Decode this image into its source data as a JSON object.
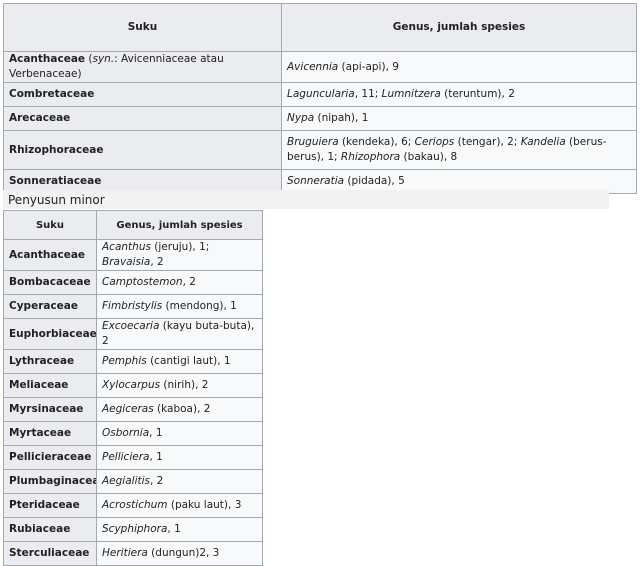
{
  "major": {
    "headers": [
      "Suku",
      "Genus, jumlah spesies"
    ],
    "rows": [
      {
        "suku": "Acanthaceae",
        "syn_pre": " (",
        "syn_label": "syn.",
        "syn_post": ": Avicenniaceae atau Verbenaceae)",
        "genus": [
          {
            "t": "Avicennia",
            "i": true
          },
          {
            "t": " (api-api), 9",
            "i": false
          }
        ]
      },
      {
        "suku": "Combretaceae",
        "genus": [
          {
            "t": "Laguncularia",
            "i": true
          },
          {
            "t": ", 11; ",
            "i": false
          },
          {
            "t": "Lumnitzera",
            "i": true
          },
          {
            "t": " (teruntum), 2",
            "i": false
          }
        ]
      },
      {
        "suku": "Arecaceae",
        "genus": [
          {
            "t": "Nypa",
            "i": true
          },
          {
            "t": " (nipah), 1",
            "i": false
          }
        ]
      },
      {
        "suku": "Rhizophoraceae",
        "genus": [
          {
            "t": "Bruguiera",
            "i": true
          },
          {
            "t": " (kendeka), 6; ",
            "i": false
          },
          {
            "t": "Ceriops",
            "i": true
          },
          {
            "t": " (tengar), 2; ",
            "i": false
          },
          {
            "t": "Kandelia",
            "i": true
          },
          {
            "t": " (berus-berus), 1; ",
            "i": false
          },
          {
            "t": "Rhizophora",
            "i": true
          },
          {
            "t": " (bakau), 8",
            "i": false
          }
        ]
      },
      {
        "suku": "Sonneratiaceae",
        "genus": [
          {
            "t": "Sonneratia",
            "i": true
          },
          {
            "t": " (pidada), 5",
            "i": false
          }
        ]
      }
    ]
  },
  "minor": {
    "heading": "Penyusun minor",
    "headers": [
      "Suku",
      "Genus, jumlah spesies"
    ],
    "rows": [
      {
        "suku": "Acanthaceae",
        "genus": [
          {
            "t": "Acanthus",
            "i": true
          },
          {
            "t": " (jeruju), 1; ",
            "i": false
          },
          {
            "t": "Bravaisia",
            "i": true
          },
          {
            "t": ", 2",
            "i": false
          }
        ]
      },
      {
        "suku": "Bombacaceae",
        "genus": [
          {
            "t": "Camptostemon",
            "i": true
          },
          {
            "t": ", 2",
            "i": false
          }
        ]
      },
      {
        "suku": "Cyperaceae",
        "genus": [
          {
            "t": "Fimbristylis",
            "i": true
          },
          {
            "t": " (mendong), 1",
            "i": false
          }
        ]
      },
      {
        "suku": "Euphorbiaceae",
        "genus": [
          {
            "t": "Excoecaria",
            "i": true
          },
          {
            "t": " (kayu buta-buta), 2",
            "i": false
          }
        ]
      },
      {
        "suku": "Lythraceae",
        "genus": [
          {
            "t": "Pemphis",
            "i": true
          },
          {
            "t": " (cantigi laut), 1",
            "i": false
          }
        ]
      },
      {
        "suku": "Meliaceae",
        "genus": [
          {
            "t": "Xylocarpus",
            "i": true
          },
          {
            "t": " (nirih), 2",
            "i": false
          }
        ]
      },
      {
        "suku": "Myrsinaceae",
        "genus": [
          {
            "t": "Aegiceras",
            "i": true
          },
          {
            "t": " (kaboa), 2",
            "i": false
          }
        ]
      },
      {
        "suku": "Myrtaceae",
        "genus": [
          {
            "t": "Osbornia",
            "i": true
          },
          {
            "t": ", 1",
            "i": false
          }
        ]
      },
      {
        "suku": "Pellicieraceae",
        "genus": [
          {
            "t": "Pelliciera",
            "i": true
          },
          {
            "t": ", 1",
            "i": false
          }
        ]
      },
      {
        "suku": "Plumbaginaceae",
        "genus": [
          {
            "t": "Aegialitis",
            "i": true
          },
          {
            "t": ", 2",
            "i": false
          }
        ]
      },
      {
        "suku": "Pteridaceae",
        "genus": [
          {
            "t": "Acrostichum",
            "i": true
          },
          {
            "t": " (paku laut), 3",
            "i": false
          }
        ]
      },
      {
        "suku": "Rubiaceae",
        "genus": [
          {
            "t": "Scyphiphora",
            "i": true
          },
          {
            "t": ", 1",
            "i": false
          }
        ]
      },
      {
        "suku": "Sterculiaceae",
        "genus": [
          {
            "t": "Heritiera",
            "i": true
          },
          {
            "t": " (dungun)2, 3",
            "i": false
          }
        ]
      }
    ]
  }
}
